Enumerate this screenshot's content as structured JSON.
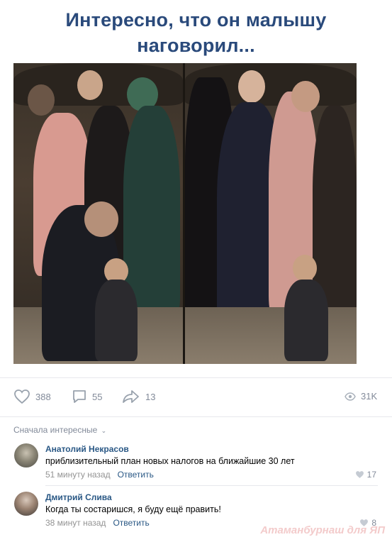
{
  "post": {
    "title_line1": "Интересно, что он малышу",
    "title_line2": "наговорил..."
  },
  "actions": {
    "likes": "388",
    "comments": "55",
    "shares": "13",
    "views": "31K"
  },
  "comments_header": {
    "sort_label": "Сначала интересные"
  },
  "comments": [
    {
      "author": "Анатолий Некрасов",
      "text": "приблизительный план новых налогов на ближайшие 30 лет",
      "time": "51 минуту назад",
      "reply_label": "Ответить",
      "likes": "17"
    },
    {
      "author": "Дмитрий Слива",
      "text": "Когда ты состаришся, я буду ещё править!",
      "time": "38 минут назад",
      "reply_label": "Ответить",
      "likes": "8"
    }
  ],
  "watermark": "Атаманбурнаш для ЯП",
  "colors": {
    "title": "#2a4a7b",
    "link": "#2a5885",
    "muted": "#828a99"
  }
}
